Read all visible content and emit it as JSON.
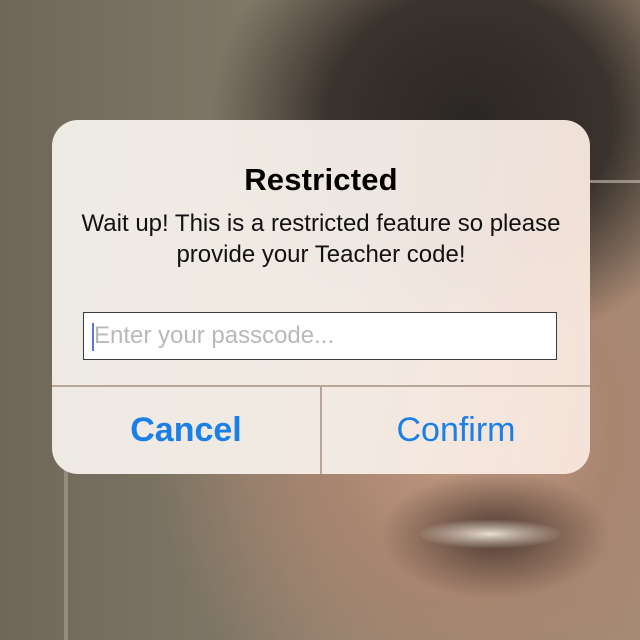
{
  "alert": {
    "title": "Restricted",
    "message": "Wait up! This is a restricted feature so please provide your Teacher code!",
    "passcode": {
      "value": "",
      "placeholder": "Enter your passcode..."
    },
    "buttons": {
      "cancel_label": "Cancel",
      "confirm_label": "Confirm"
    }
  },
  "colors": {
    "button_text": "#1a7fe6",
    "caret": "#5b77d6"
  }
}
